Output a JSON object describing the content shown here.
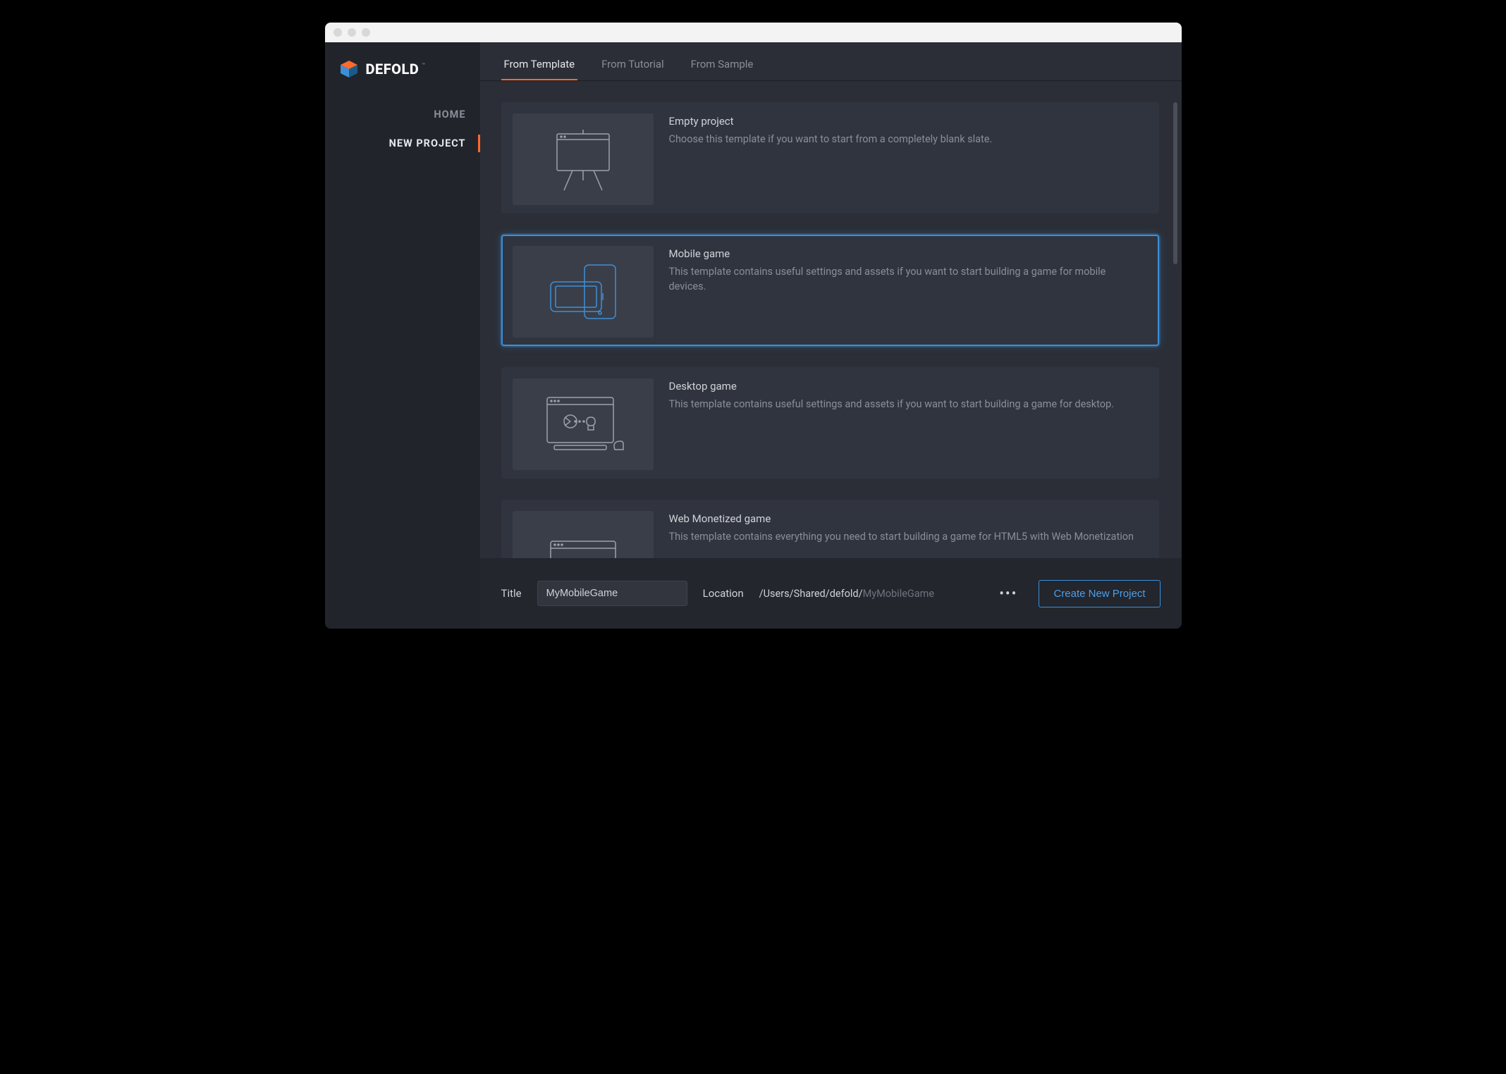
{
  "brand": {
    "name": "DEFOLD"
  },
  "sidebar": {
    "items": [
      {
        "label": "HOME",
        "active": false
      },
      {
        "label": "NEW PROJECT",
        "active": true
      }
    ]
  },
  "tabs": [
    {
      "label": "From Template",
      "active": true
    },
    {
      "label": "From Tutorial",
      "active": false
    },
    {
      "label": "From Sample",
      "active": false
    }
  ],
  "templates": [
    {
      "title": "Empty project",
      "desc": "Choose this template if you want to start from a completely blank slate.",
      "selected": false,
      "icon": "easel"
    },
    {
      "title": "Mobile game",
      "desc": "This template contains useful settings and assets if you want to start building a game for mobile devices.",
      "selected": true,
      "icon": "mobile"
    },
    {
      "title": "Desktop game",
      "desc": "This template contains useful settings and assets if you want to start building a game for desktop.",
      "selected": false,
      "icon": "desktop"
    },
    {
      "title": "Web Monetized game",
      "desc": "This template contains everything you need to start building a game for HTML5 with Web Monetization",
      "selected": false,
      "icon": "web"
    }
  ],
  "footer": {
    "title_label": "Title",
    "title_value": "MyMobileGame",
    "location_label": "Location",
    "location_base": "/Users/Shared/defold/",
    "location_suffix": "MyMobileGame",
    "more_label": "•••",
    "create_label": "Create New Project"
  }
}
